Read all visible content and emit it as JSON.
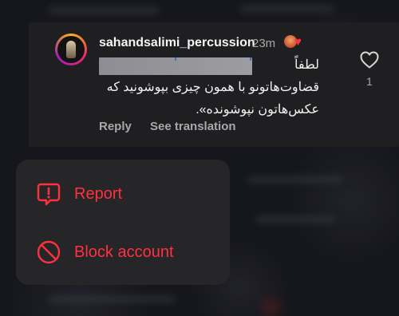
{
  "comment": {
    "username": "sahandsalimi_percussion",
    "time": "23m",
    "text_line1": "لطفاً",
    "text_line2": "قضاوت‌هاتونو با همون چیزی بپوشونید که",
    "text_line3": "عکس‌هاتون نپوشونده».",
    "like_count": "1",
    "reply_label": "Reply",
    "translate_label": "See translation"
  },
  "menu": {
    "items": [
      {
        "label": "Report",
        "icon": "report-icon"
      },
      {
        "label": "Block account",
        "icon": "block-icon"
      }
    ]
  },
  "colors": {
    "danger": "#ff3040",
    "muted": "#a8a8a8",
    "card": "#1f1f21",
    "menu": "#262628"
  }
}
